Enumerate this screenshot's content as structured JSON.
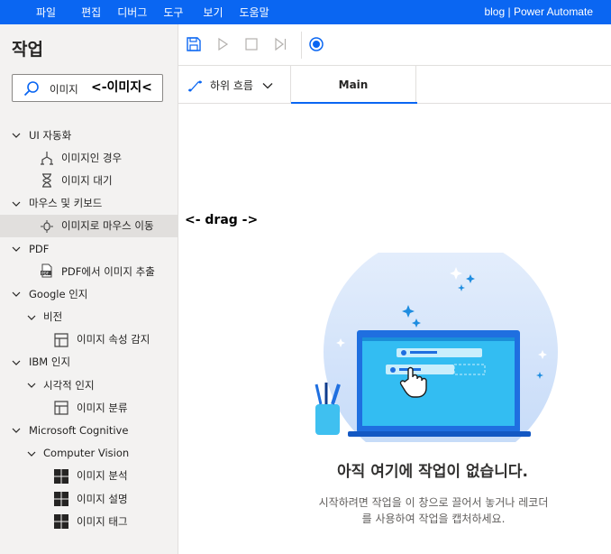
{
  "menubar": {
    "items": [
      "파일",
      "편집",
      "디버그",
      "도구",
      "보기",
      "도움말"
    ],
    "brand": "blog | Power Automate"
  },
  "actions_panel": {
    "title": "작업",
    "search": {
      "value": "이미지",
      "annotation": "<-이미지<"
    }
  },
  "tree": [
    {
      "label": "UI 자동화",
      "type": "group",
      "expanded": true
    },
    {
      "label": "이미지인 경우",
      "type": "action",
      "icon": "if-branch-icon"
    },
    {
      "label": "이미지 대기",
      "type": "action",
      "icon": "hourglass-icon"
    },
    {
      "label": "마우스 및 키보드",
      "type": "group",
      "expanded": true
    },
    {
      "label": "이미지로 마우스 이동",
      "type": "action",
      "icon": "mouse-move-icon",
      "selected": true
    },
    {
      "label": "PDF",
      "type": "group",
      "expanded": true
    },
    {
      "label": "PDF에서 이미지 추출",
      "type": "action",
      "icon": "pdf-icon"
    },
    {
      "label": "Google 인지",
      "type": "group",
      "expanded": true
    },
    {
      "label": "비전",
      "type": "subgroup",
      "expanded": true
    },
    {
      "label": "이미지 속성 감지",
      "type": "subaction",
      "icon": "layout-icon"
    },
    {
      "label": "IBM 인지",
      "type": "group",
      "expanded": true
    },
    {
      "label": "시각적 인지",
      "type": "subgroup",
      "expanded": true
    },
    {
      "label": "이미지 분류",
      "type": "subaction",
      "icon": "layout-icon"
    },
    {
      "label": "Microsoft Cognitive",
      "type": "group",
      "expanded": true
    },
    {
      "label": "Computer Vision",
      "type": "subgroup",
      "expanded": true
    },
    {
      "label": "이미지 분석",
      "type": "subaction",
      "icon": "windows-icon"
    },
    {
      "label": "이미지 설명",
      "type": "subaction",
      "icon": "windows-icon"
    },
    {
      "label": "이미지 태그",
      "type": "subaction",
      "icon": "windows-icon"
    }
  ],
  "toolbar": {
    "buttons": [
      "save-icon",
      "run-icon",
      "stop-icon",
      "step-icon",
      "record-icon"
    ]
  },
  "tabs": {
    "subflow_label": "하위 흐름",
    "main_tab": "Main"
  },
  "canvas": {
    "drag_annotation": "<- drag ->",
    "empty_title": "아직 여기에 작업이 없습니다.",
    "empty_desc_line1": "시작하려면 작업을 이 창으로 끌어서 놓거나 레코더",
    "empty_desc_line2": "를 사용하여 작업을 캡처하세요."
  },
  "colors": {
    "accent": "#0a66f2",
    "panel_bg": "#f3f2f1",
    "illustration_bg": "#cfe0fa",
    "laptop": "#1d74e6",
    "screen": "#2ab7f0"
  }
}
